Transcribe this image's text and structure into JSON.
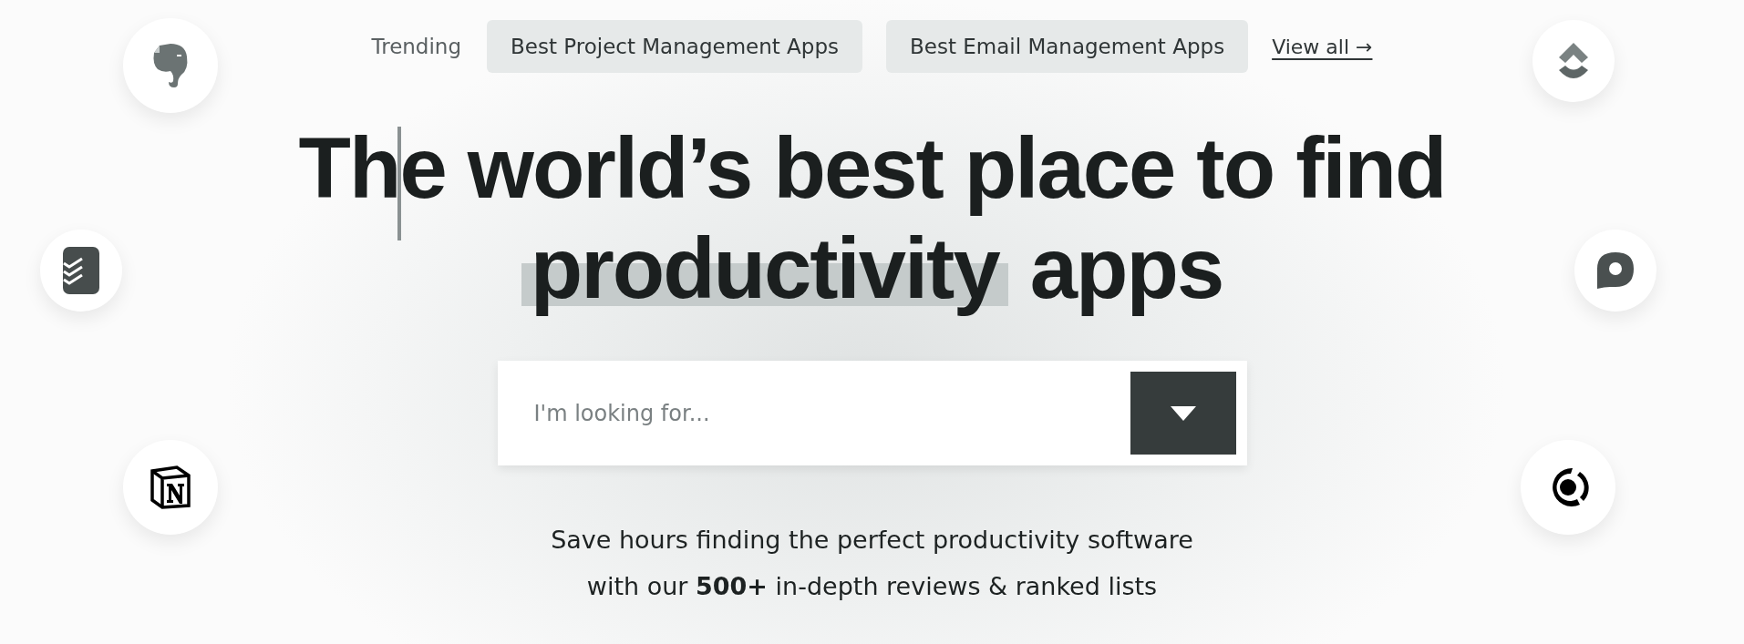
{
  "trending": {
    "label": "Trending",
    "chips": [
      {
        "label": "Best Project Management Apps"
      },
      {
        "label": "Best Email Management Apps"
      }
    ],
    "view_all": "View all →"
  },
  "headline": {
    "text_before": "The world’s best place to find",
    "highlighted": "productivity",
    "text_after": "apps"
  },
  "search": {
    "placeholder": "I'm looking for..."
  },
  "subtitle_lines": [
    "Save hours finding the perfect productivity software",
    "with our **500+** in-depth reviews & ranked lists"
  ]
}
